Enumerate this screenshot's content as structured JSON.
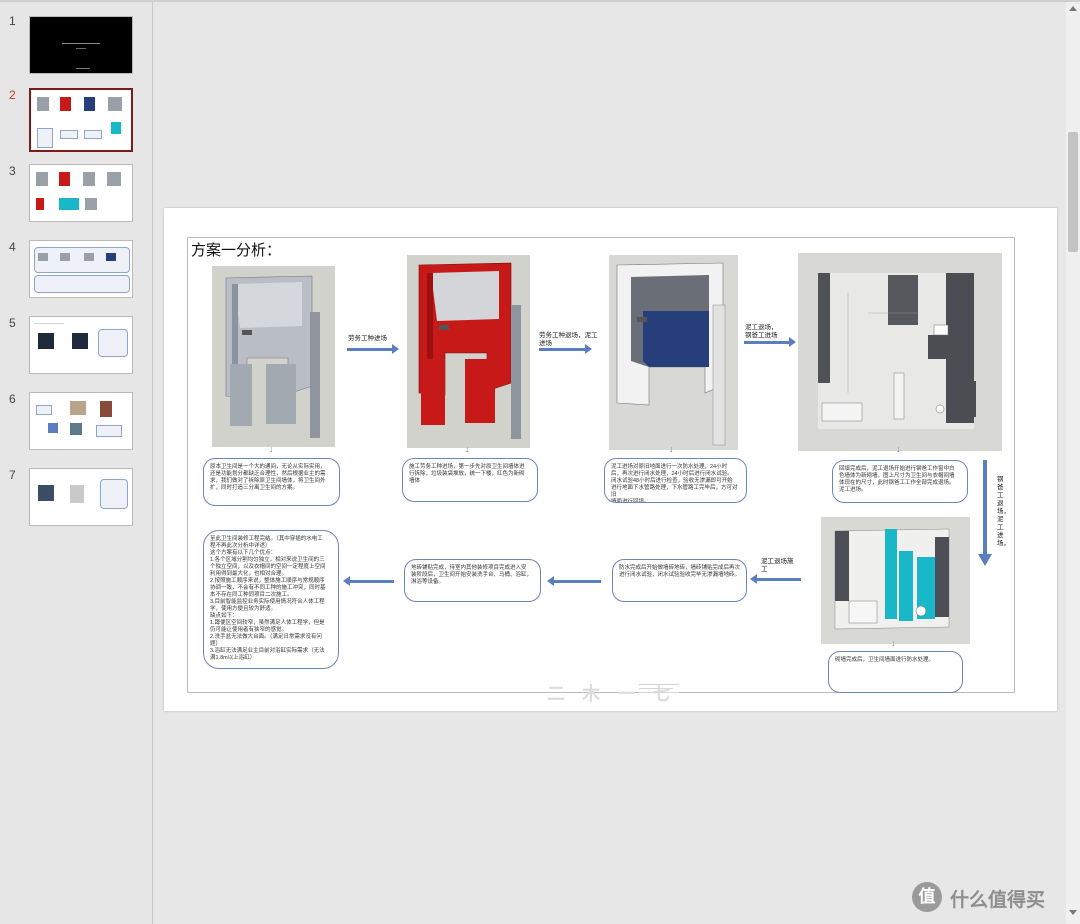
{
  "thumbnails": [
    {
      "number": "1",
      "active": false
    },
    {
      "number": "2",
      "active": true
    },
    {
      "number": "3",
      "active": false
    },
    {
      "number": "4",
      "active": false
    },
    {
      "number": "5",
      "active": false
    },
    {
      "number": "6",
      "active": false
    },
    {
      "number": "7",
      "active": false
    }
  ],
  "slide": {
    "title": "方案一分析：",
    "arrows": {
      "a1": "劳务工种进场",
      "a2": "劳务工种退场，泥工进场",
      "a3": "泥工退场，\n钢爸工进场",
      "a4": "钢爸工退场，泥工进场，",
      "a5": "泥工退场施工",
      "a6": ""
    },
    "bubbles": {
      "b1": [
        "原本卫生间是一个大的通间，无论从实际实用，",
        "还是功能划分都缺乏合理性，然后根据业主的需",
        "求，我们做对了拆除原卫生间墙体，将卫生间外",
        "扩，同时打造三分离卫生间的方案。"
      ],
      "b2": [
        "施工劳务工种进场，第一步先对原卫生间墙体进",
        "行拆除，垃圾装袋堆放，统一下楼，红色为新砌",
        "墙体"
      ],
      "b3": [
        "泥工进场对原旧地面进行一次防水处理，24小时",
        "后，再次进行闭水处理，24小时后进行闭水试验。",
        "闭水试验48小时后进行检查，验收无渗漏即可开始",
        "进行地面下水管路处理，下水管路工完毕后，方可对旧",
        "墙面进行回填。"
      ],
      "b4": [
        "回填完成后，泥工退场开始进行钢爸工作窗中白",
        "色墙体为新砌墙，图上尺寸为卫生间与衣帽间墙",
        "体现在的尺寸，此时钢爸工工作全部完成退场。",
        "泥工进场。"
      ],
      "b5": [
        "砌墙完成后，卫生间墙面进行防水处理。"
      ],
      "b6": [
        "防水完成后开始做墙砖地砖，墙砖铺贴完成后再次",
        "进行闭水试验，闭水试验验收完毕无渗漏墙地砖。"
      ],
      "b7": [
        "地砖铺贴完成，待室内其他装修项目完成进入安",
        "装阶段后，卫生间开始安装洗手台、马桶、浴缸，",
        "淋浴等设备。"
      ],
      "b8": [
        "至此卫生间装修工程完结。（其中穿插的水电工",
        "程不再此次分析中详述）",
        "这个方案有以下几个优点：",
        "1.各个区域分割均匀独立，相对来说卫生间的三",
        "个独立空间，以及衣帽间的空间一定程度上空间",
        "利用得到最大化，也相对合理。",
        "2.按照施工顺序来说，整体施工顺序与常规顺序",
        "协调一致，不会有不同工种的施工冲突，同时基",
        "本不存在同工种同项目二次施工。",
        "3.目前智能监控业务实际使用情况符合人体工程",
        "学，使用方便且较为舒适。",
        "缺点如下：",
        "1.蹲便区空间较窄，虽然满足人体工程学，但是",
        "仍可能让使用者有狭窄的感觉。",
        "2.洗手盆无法做大台面。（满足日常需求没有问",
        "题）",
        "3.浴缸无法满足业主目前对浴缸实际需求（无法",
        "满1.8m以上浴缸）"
      ]
    },
    "watermark": "二 木 一 七"
  },
  "brand": {
    "icon": "值",
    "text": "什么值得买"
  },
  "colors": {
    "accent": "#5b7fbd",
    "active_thumb": "#7b1b1b",
    "demolition_red": "#c81919",
    "waterproof_blue": "#263e7a",
    "tile_cyan": "#19b7c8"
  }
}
